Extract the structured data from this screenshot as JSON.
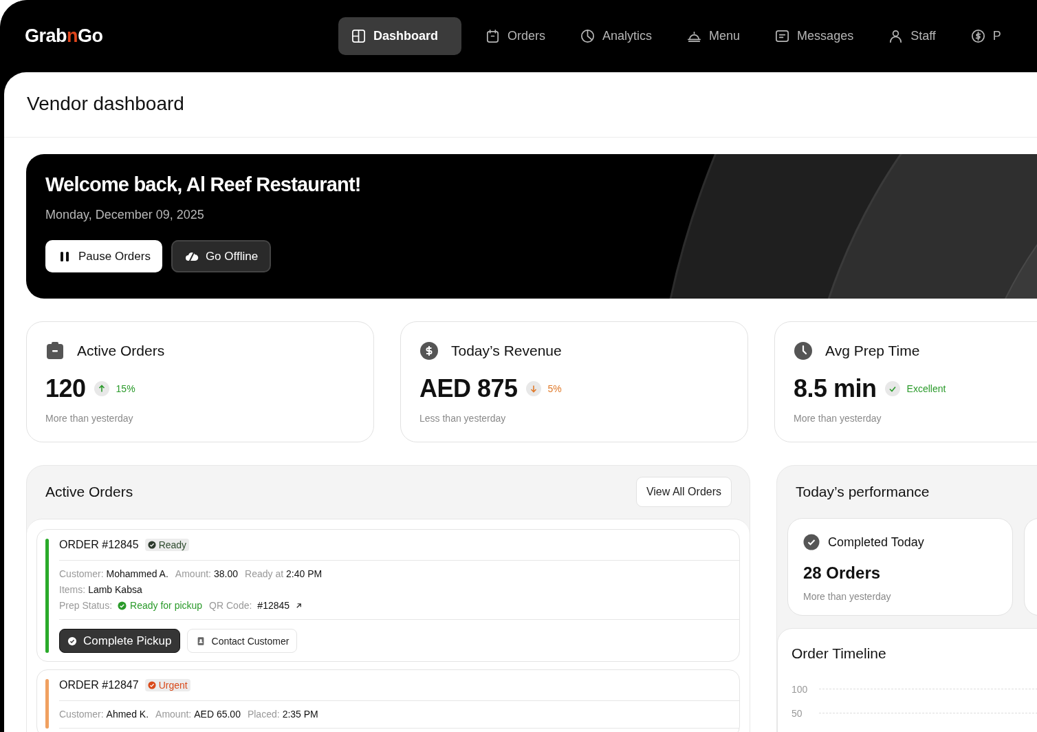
{
  "brand": {
    "before": "Grab",
    "accent": "n",
    "after": "Go"
  },
  "nav": [
    {
      "label": "Dashboard",
      "selected": true
    },
    {
      "label": "Orders",
      "selected": false
    },
    {
      "label": "Analytics",
      "selected": false
    },
    {
      "label": "Menu",
      "selected": false
    },
    {
      "label": "Messages",
      "selected": false
    },
    {
      "label": "Staff",
      "selected": false
    },
    {
      "label": "P",
      "selected": false
    }
  ],
  "page_title": "Vendor dashboard",
  "welcome": {
    "title": "Welcome back, Al Reef Restaurant!",
    "date": "Monday, December 09, 2025",
    "buttons": [
      {
        "label": "Pause Orders",
        "kind": "light"
      },
      {
        "label": "Go Offline",
        "kind": "dark"
      }
    ]
  },
  "stats": [
    {
      "title": "Active Orders",
      "value": "120",
      "change": "15%",
      "kind": "up",
      "note": "More than yesterday"
    },
    {
      "title": "Today’s Revenue",
      "value": "AED 875",
      "change": "5%",
      "kind": "down",
      "note": "Less than yesterday"
    },
    {
      "title": "Avg Prep Time",
      "value": "8.5 min",
      "change": "Excellent",
      "kind": "good",
      "note": "More than yesterday"
    }
  ],
  "active_orders": {
    "title": "Active Orders",
    "view_all": "View All Orders",
    "orders": [
      {
        "number": "ORDER #12845",
        "status": {
          "label": "Ready",
          "kind": "ready"
        },
        "lines": [
          [
            {
              "label": "Customer:",
              "value": "Mohammed A.",
              "kind": "text"
            },
            {
              "label": "Amount:",
              "value": "38.00",
              "kind": "text"
            },
            {
              "label": "Ready at",
              "value": "2:40 PM",
              "kind": "text"
            }
          ],
          [
            {
              "label": "Items:",
              "value": "Lamb Kabsa",
              "kind": "text"
            }
          ],
          [
            {
              "label": "Prep Status:",
              "value": "Ready for pickup",
              "kind": "status"
            },
            {
              "label": "QR Code:",
              "value": "#12845",
              "kind": "link"
            }
          ]
        ],
        "actions": [
          {
            "label": "Complete Pickup",
            "kind": "primary"
          },
          {
            "label": "Contact Customer",
            "kind": "secondary"
          }
        ]
      },
      {
        "number": "ORDER #12847",
        "status": {
          "label": "Urgent",
          "kind": "urgent"
        },
        "lines": [
          [
            {
              "label": "Customer:",
              "value": "Ahmed K.",
              "kind": "text"
            },
            {
              "label": "Amount:",
              "value": "AED 65.00",
              "kind": "text"
            },
            {
              "label": "Placed:",
              "value": "2:35 PM",
              "kind": "text"
            }
          ]
        ]
      }
    ]
  },
  "performance": {
    "title": "Today’s performance",
    "cards": [
      {
        "title": "Completed Today",
        "value": "28 Orders",
        "note": "More than yesterday"
      }
    ],
    "timeline": {
      "title": "Order Timeline",
      "axis_labels": [
        "100",
        "50"
      ]
    }
  }
}
